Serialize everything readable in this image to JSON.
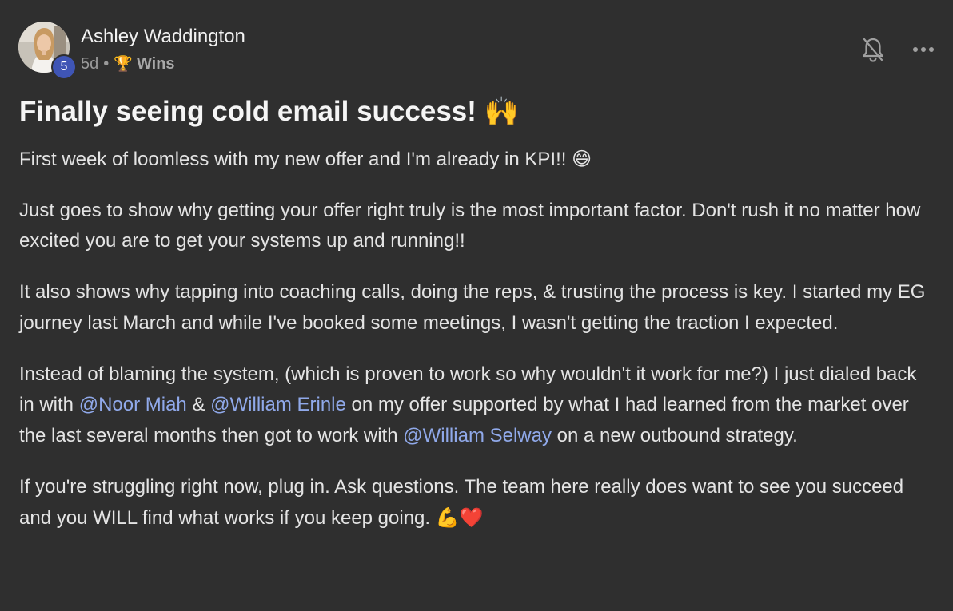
{
  "post": {
    "author": {
      "name": "Ashley Waddington",
      "level": "5"
    },
    "meta": {
      "time": "5d",
      "separator": "•",
      "category_icon": "trophy-icon",
      "category_emoji": "🏆",
      "category": "Wins"
    },
    "actions": {
      "notifications_icon": "bell-off-icon",
      "more_icon": "more-horizontal-icon"
    },
    "title": "Finally seeing cold email success!",
    "title_emoji": "🙌",
    "paragraphs": {
      "p1": {
        "text": "First week of loomless with my new offer and I'm already in KPI!!",
        "emoji": "😄"
      },
      "p2": "Just goes to show why getting your offer right truly is the most important factor. Don't rush it no matter how excited you are to get your systems up and running!!",
      "p3": "It also shows why tapping into coaching calls, doing the reps, & trusting the process is key. I started my EG journey last March and while I've booked some meetings, I wasn't getting the traction I expected.",
      "p4": {
        "part1": "Instead of blaming the system, (which is proven to work so why wouldn't it work for me?) I just dialed back in with",
        "mention1": "@Noor Miah",
        "part2": "&",
        "mention2": "@William Erinle",
        "part3": "on my offer supported by what I had learned from the market over the last several months then got to work with",
        "mention3": "@William Selway",
        "part4": "on a new outbound strategy."
      },
      "p5": {
        "text": "If you're struggling right now, plug in. Ask questions. The team here really does want to see you succeed and you WILL find what works if you keep going.",
        "emoji1": "💪",
        "emoji2": "❤️"
      }
    },
    "colors": {
      "background": "#2f2f2f",
      "mention": "#90a9ea",
      "level_badge": "#3f55b5"
    }
  }
}
